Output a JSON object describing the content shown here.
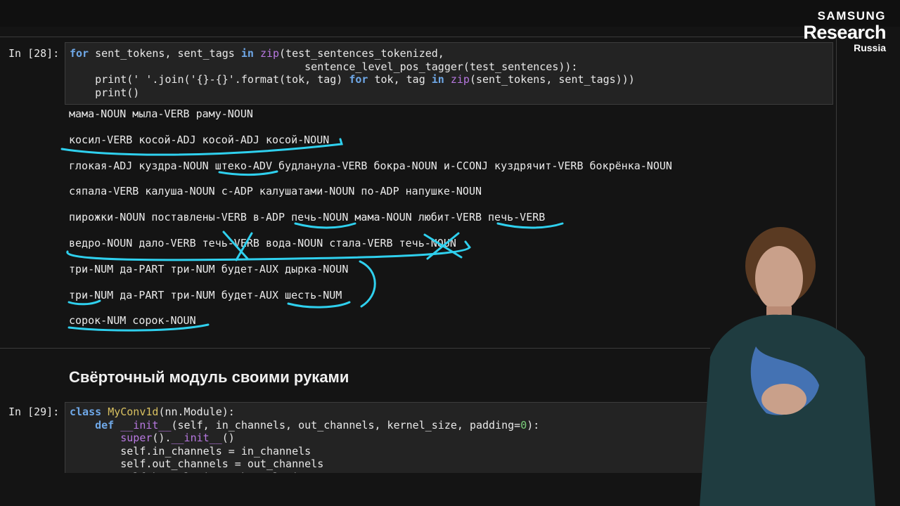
{
  "cells": [
    {
      "prompt": "In [28]:",
      "code": [
        [
          {
            "t": "for",
            "c": "kw"
          },
          {
            "t": " sent_tokens, sent_tags "
          },
          {
            "t": "in",
            "c": "kw"
          },
          {
            "t": " "
          },
          {
            "t": "zip",
            "c": "fn"
          },
          {
            "t": "(test_sentences_tokenized,"
          }
        ],
        [
          {
            "t": "                                     sentence_level_pos_tagger(test_sentences)):"
          }
        ],
        [
          {
            "t": "    print(' '.join('{}-{}'.format(tok, tag) "
          },
          {
            "t": "for",
            "c": "kw"
          },
          {
            "t": " tok, tag "
          },
          {
            "t": "in",
            "c": "kw"
          },
          {
            "t": " "
          },
          {
            "t": "zip",
            "c": "fn"
          },
          {
            "t": "(sent_tokens, sent_tags)))"
          }
        ],
        [
          {
            "t": "    print()"
          }
        ]
      ],
      "output": [
        "мама-NOUN мыла-VERB раму-NOUN",
        "косил-VERB косой-ADJ косой-ADJ косой-NOUN",
        "глокая-ADJ куздра-NOUN штеко-ADV будланула-VERB бокра-NOUN и-CCONJ куздрячит-VERB бокрёнка-NOUN",
        "сяпала-VERB калуша-NOUN с-ADP калушатами-NOUN по-ADP напушке-NOUN",
        "пирожки-NOUN поставлены-VERB в-ADP печь-NOUN мама-NOUN любит-VERB печь-VERB",
        "ведро-NOUN дало-VERB течь-VERB вода-NOUN стала-VERB течь-NOUN",
        "три-NUM да-PART три-NUM будет-AUX дырка-NOUN",
        "три-NUM да-PART три-NUM будет-AUX шесть-NUM",
        "сорок-NUM сорок-NOUN"
      ]
    },
    {
      "prompt": "In [29]:",
      "code": [
        [
          {
            "t": "class",
            "c": "kw"
          },
          {
            "t": " "
          },
          {
            "t": "MyConv1d",
            "c": "cls"
          },
          {
            "t": "(nn.Module):"
          }
        ],
        [
          {
            "t": "    "
          },
          {
            "t": "def",
            "c": "kw"
          },
          {
            "t": " "
          },
          {
            "t": "__init__",
            "c": "fn"
          },
          {
            "t": "(self, in_channels, out_channels, kernel_size, padding="
          },
          {
            "t": "0",
            "c": "num"
          },
          {
            "t": "):"
          }
        ],
        [
          {
            "t": "        "
          },
          {
            "t": "super",
            "c": "fn"
          },
          {
            "t": "()."
          },
          {
            "t": "__init__",
            "c": "fn"
          },
          {
            "t": "()"
          }
        ],
        [
          {
            "t": "        self.in_channels = in_channels"
          }
        ],
        [
          {
            "t": "        self.out_channels = out_channels"
          }
        ],
        [
          {
            "t": "        self.kernel_size = kernel_size"
          }
        ]
      ]
    }
  ],
  "heading": "Свёрточный модуль своими руками",
  "logo": {
    "line1": "SAMSUNG",
    "line2": "Research",
    "line3": "Russia"
  },
  "colors": {
    "annotation": "#2fd0ee",
    "keyword": "#6fa8e8",
    "builtin": "#b778e0",
    "classname": "#d8c060",
    "number": "#7ccf7c"
  }
}
